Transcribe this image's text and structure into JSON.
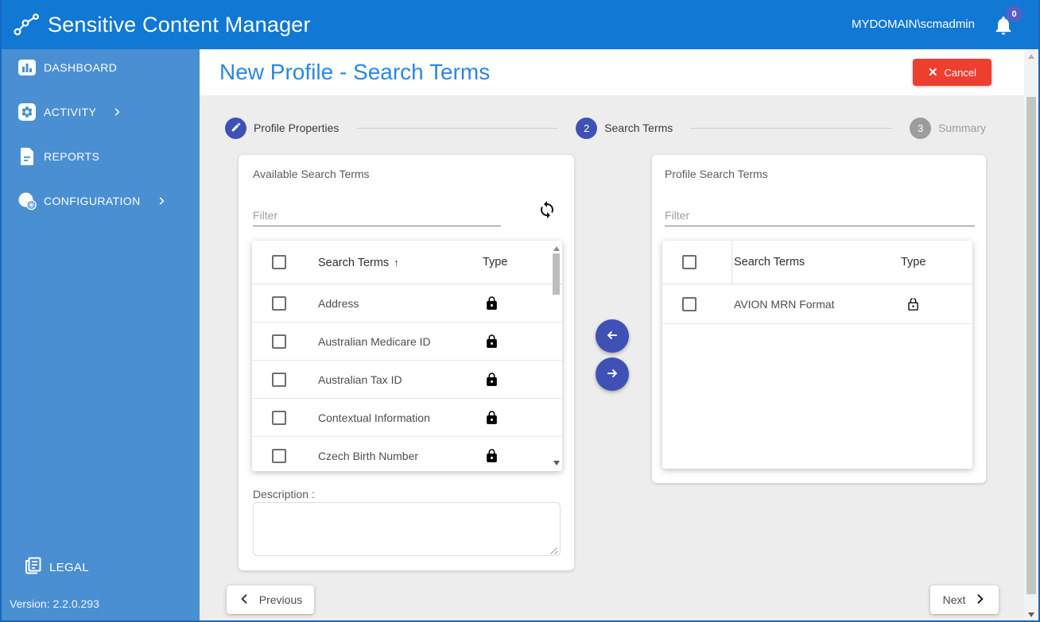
{
  "colors": {
    "header_blue": "#1178d4",
    "sidebar_blue": "#4a8fd2",
    "page_title_blue": "#2b87de",
    "accent_indigo": "#3f51b5",
    "cancel_red": "#ee3e30",
    "badge_indigo": "#5560c5"
  },
  "header": {
    "app_title": "Sensitive Content Manager",
    "user": "MYDOMAIN\\scmadmin",
    "notification_count": "0",
    "logo_icon": "connected-nodes-icon",
    "bell_icon": "bell-icon"
  },
  "sidebar": {
    "items": [
      {
        "label": "DASHBOARD",
        "icon": "bar-chart-icon",
        "has_submenu": false
      },
      {
        "label": "ACTIVITY",
        "icon": "gear-icon",
        "has_submenu": true
      },
      {
        "label": "REPORTS",
        "icon": "report-icon",
        "has_submenu": false
      },
      {
        "label": "CONFIGURATION",
        "icon": "configuration-icon",
        "has_submenu": true
      }
    ],
    "legal": {
      "label": "LEGAL",
      "icon": "legal-book-icon"
    },
    "version": "Version: 2.2.0.293"
  },
  "page": {
    "title": "New Profile - Search Terms",
    "cancel_button": "Cancel"
  },
  "stepper": {
    "steps": [
      {
        "label": "Profile Properties",
        "indicator": "edit-icon",
        "state": "completed"
      },
      {
        "label": "Search Terms",
        "indicator": "2",
        "state": "active"
      },
      {
        "label": "Summary",
        "indicator": "3",
        "state": "upcoming"
      }
    ]
  },
  "available_panel": {
    "title": "Available Search Terms",
    "filter_placeholder": "Filter",
    "refresh_icon": "refresh-icon",
    "table": {
      "columns": [
        "Search Terms",
        "Type"
      ],
      "sort_column": "Search Terms",
      "sort_direction": "asc",
      "rows": [
        {
          "term": "Address",
          "type": "locked"
        },
        {
          "term": "Australian Medicare ID",
          "type": "locked"
        },
        {
          "term": "Australian Tax ID",
          "type": "locked"
        },
        {
          "term": "Contextual Information",
          "type": "locked"
        },
        {
          "term": "Czech Birth Number",
          "type": "locked"
        }
      ]
    },
    "description_label": "Description :",
    "description_value": ""
  },
  "transfer": {
    "move_left_icon": "arrow-left-icon",
    "move_right_icon": "arrow-right-icon"
  },
  "profile_panel": {
    "title": "Profile Search Terms",
    "filter_placeholder": "Filter",
    "table": {
      "columns": [
        "Search Terms",
        "Type"
      ],
      "rows": [
        {
          "term": "AVION MRN Format",
          "type": "unlocked"
        }
      ]
    }
  },
  "footer": {
    "previous_label": "Previous",
    "next_label": "Next"
  }
}
